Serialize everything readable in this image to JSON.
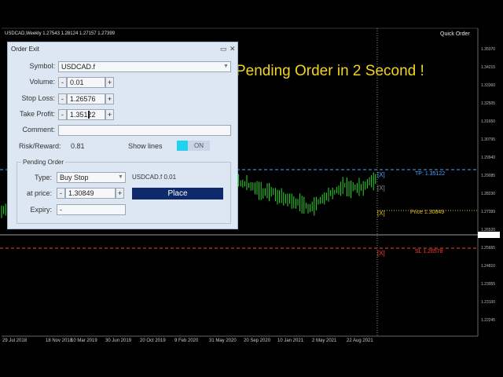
{
  "chart": {
    "symbol_title": "USDCAD,Weekly  1.27543 1.28124 1.27157 1.27399",
    "quick_order_label": "Quick Order",
    "banner_text": "Pending Order in 2 Second !",
    "y_axis_labels": [
      "1.35070",
      "1.34215",
      "1.33360",
      "1.32505",
      "1.31650",
      "1.30795",
      "1.29940",
      "1.29085",
      "1.28230",
      "1.27399",
      "1.26520",
      "1.25665",
      "1.24810",
      "1.23955",
      "1.23100",
      "1.22245"
    ],
    "x_axis_labels": [
      "29 Jul 2018",
      "18 Nov 2018",
      "10 Mar 2019",
      "30 Jun 2019",
      "20 Oct 2019",
      "9 Feb 2020",
      "31 May 2020",
      "20 Sep 2020",
      "10 Jan 2021",
      "2 May 2021",
      "22 Aug 2021"
    ],
    "tp_label": "TP: 1.35122",
    "price_label": "Price 1.30849",
    "sl_label": "SL 1.26578",
    "x_marker": "[X]",
    "colors": {
      "tp": "#4aa3ff",
      "price": "#e0c21a",
      "sl": "#ff3b30",
      "candles": "#2bd92b",
      "banner": "#f2d51c"
    }
  },
  "dialog": {
    "title": "Order Exit",
    "min_icon": "minimize-icon",
    "close_icon": "close-icon",
    "symbol_label": "Symbol:",
    "symbol_value": "USDCAD.f",
    "volume_label": "Volume:",
    "volume_value": "0.01",
    "stoploss_label": "Stop Loss:",
    "stoploss_value": "1.26576",
    "takeprofit_label": "Take Profit:",
    "takeprofit_value": "1.35122",
    "comment_label": "Comment:",
    "comment_value": "",
    "riskreward_label": "Risk/Reward:",
    "riskreward_value": "0.81",
    "showlines_label": "Show lines",
    "showlines_state": "ON",
    "pending": {
      "group_title": "Pending Order",
      "type_label": "Type:",
      "type_value": "Buy Stop",
      "info": "USDCAD.f  0.01",
      "price_label": "at price:",
      "price_value": "1.30849",
      "expiry_label": "Expiry:",
      "expiry_value": "-",
      "place_label": "Place"
    },
    "minus": "-",
    "plus": "+"
  }
}
